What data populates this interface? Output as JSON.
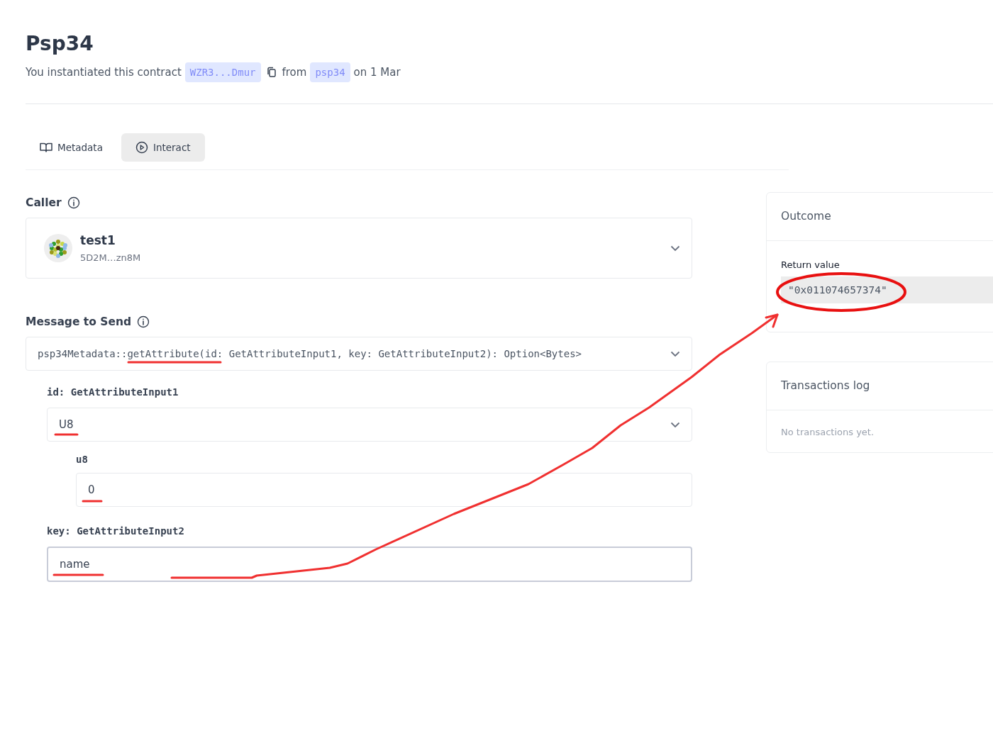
{
  "contract": {
    "title": "Psp34",
    "intro": "You instantiated this contract",
    "address": "WZR3...Dmur",
    "from_text": "from",
    "code": "psp34",
    "date_text": "on 1 Mar"
  },
  "tabs": [
    {
      "label": "Metadata",
      "kind": "book",
      "selected": false
    },
    {
      "label": "Interact",
      "kind": "play",
      "selected": true
    }
  ],
  "caller": {
    "label": "Caller",
    "name": "test1",
    "address": "5D2M…zn8M"
  },
  "message": {
    "label": "Message to Send",
    "value": "psp34Metadata::getAttribute(id: GetAttributeInput1, key: GetAttributeInput2): Option<Bytes>"
  },
  "id_arg": {
    "label": "id: GetAttributeInput1",
    "variant": "U8",
    "sub_label": "u8",
    "sub_value": "0"
  },
  "key_arg": {
    "label": "key: GetAttributeInput2",
    "value": "name"
  },
  "outcome": {
    "title": "Outcome",
    "return_label": "Return value",
    "return_value": "\"0x011074657374\""
  },
  "transactions": {
    "title": "Transactions log",
    "empty": "No transactions yet."
  }
}
